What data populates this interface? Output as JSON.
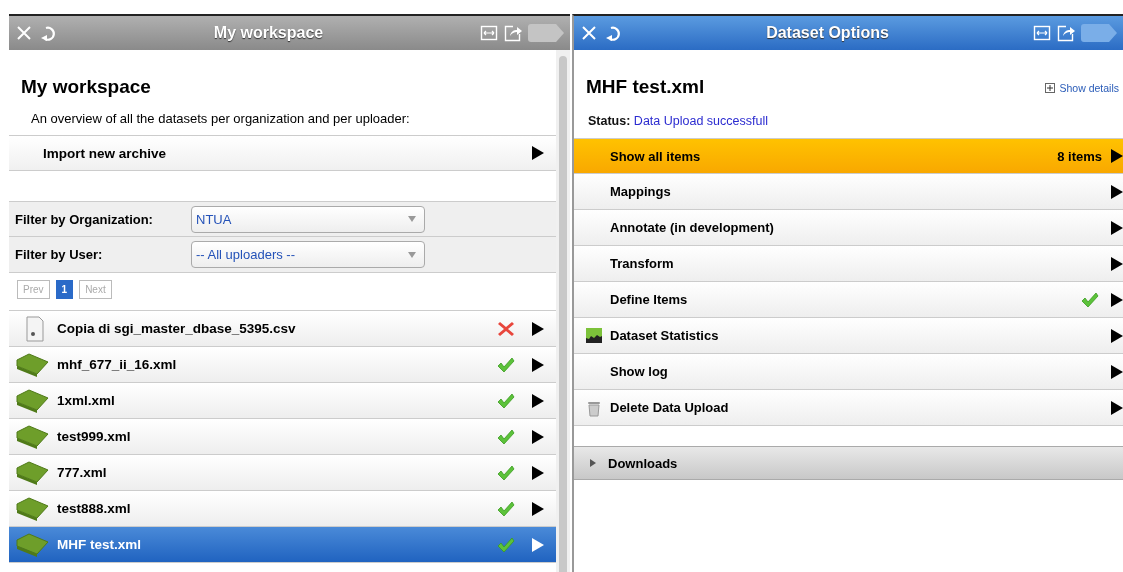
{
  "left_panel": {
    "title": "My workspace",
    "active": false,
    "heading": "My workspace",
    "description": "An overview of all the datasets per organization and per uploader:",
    "import_row": {
      "label": "Import new archive"
    },
    "filters": [
      {
        "label": "Filter by Organization:",
        "value": "NTUA"
      },
      {
        "label": "Filter by User:",
        "value": "-- All uploaders --"
      }
    ],
    "pagination": [
      {
        "label": "Prev",
        "selected": false,
        "disabled": true
      },
      {
        "label": "1",
        "selected": true,
        "disabled": false
      },
      {
        "label": "Next",
        "selected": false,
        "disabled": true
      }
    ],
    "files": [
      {
        "name": "Copia di sgi_master_dbase_5395.csv",
        "kind": "csv",
        "failed": true,
        "selected": false
      },
      {
        "name": "mhf_677_ii_16.xml",
        "kind": "xml",
        "failed": false,
        "selected": false
      },
      {
        "name": "1xml.xml",
        "kind": "xml",
        "failed": false,
        "selected": false
      },
      {
        "name": "test999.xml",
        "kind": "xml",
        "failed": false,
        "selected": false
      },
      {
        "name": "777.xml",
        "kind": "xml",
        "failed": false,
        "selected": false
      },
      {
        "name": "test888.xml",
        "kind": "xml",
        "failed": false,
        "selected": false
      },
      {
        "name": "MHF test.xml",
        "kind": "xml",
        "failed": false,
        "selected": true
      }
    ]
  },
  "right_panel": {
    "title": "Dataset Options",
    "active": true,
    "heading": "MHF test.xml",
    "show_details": "Show details",
    "status": {
      "label": "Status:",
      "value": "Data Upload successfull"
    },
    "menu": [
      {
        "label": "Show all items",
        "kind": "plain",
        "count": "8 items",
        "done": false,
        "selected": true
      },
      {
        "label": "Mappings",
        "kind": "plain",
        "done": false,
        "selected": false
      },
      {
        "label": "Annotate (in development)",
        "kind": "plain",
        "done": false,
        "selected": false
      },
      {
        "label": "Transform",
        "kind": "plain",
        "done": false,
        "selected": false
      },
      {
        "label": "Define Items",
        "kind": "plain",
        "done": true,
        "selected": false
      },
      {
        "label": "Dataset Statistics",
        "kind": "chart",
        "done": false,
        "selected": false
      },
      {
        "label": "Show log",
        "kind": "plain",
        "done": false,
        "selected": false
      },
      {
        "label": "Delete Data Upload",
        "kind": "trash",
        "done": false,
        "selected": false
      }
    ],
    "downloads": {
      "label": "Downloads",
      "expanded": false
    }
  }
}
